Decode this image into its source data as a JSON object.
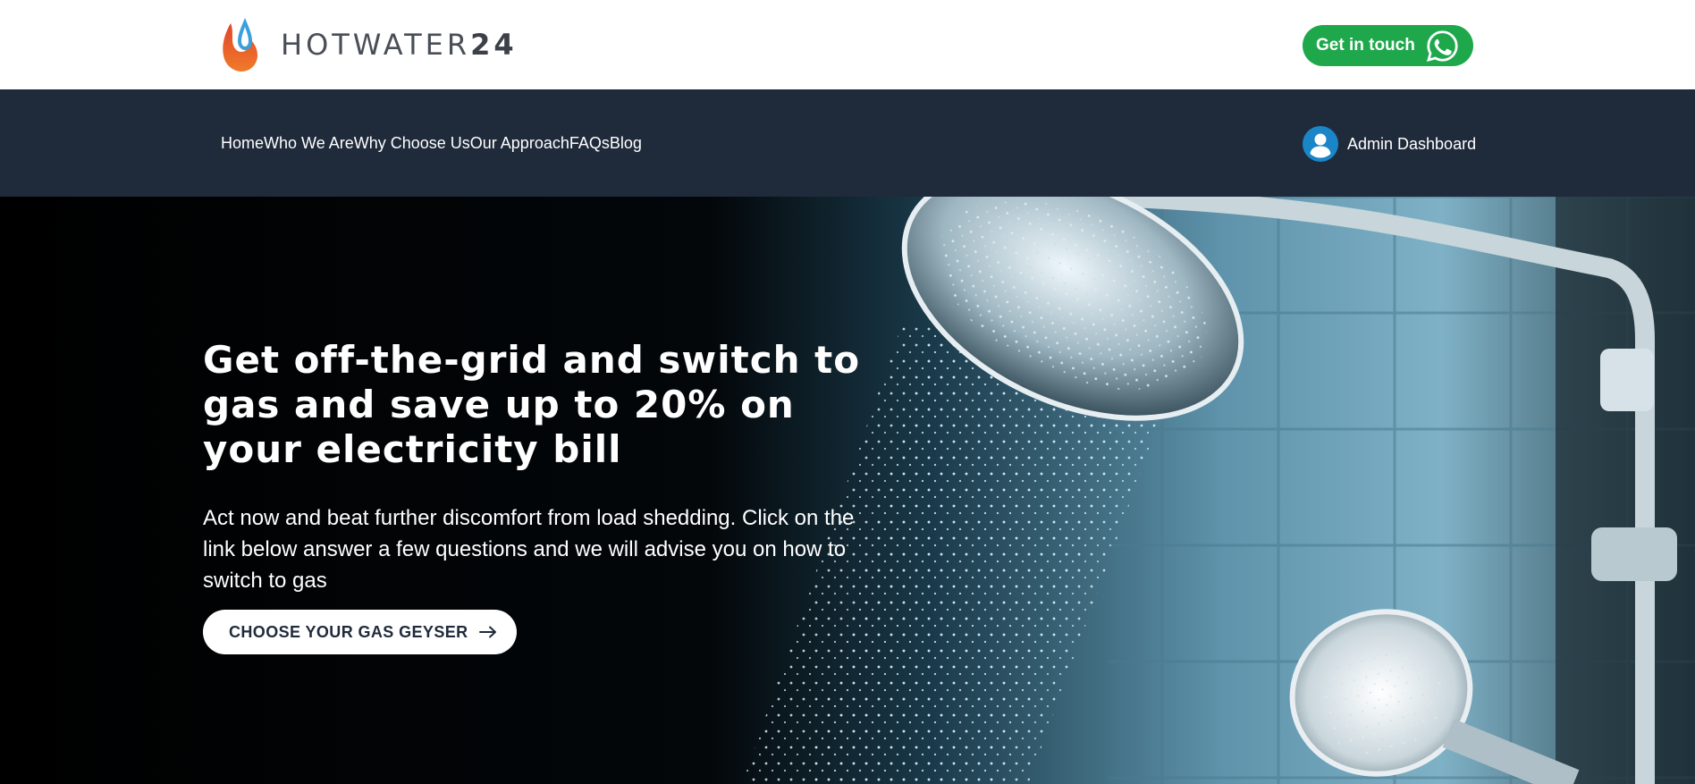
{
  "header": {
    "logo_word": "HOTWATER",
    "logo_number": "24",
    "cta_label": "Get in touch",
    "cta_icon": "whatsapp-icon"
  },
  "nav": {
    "items": [
      {
        "label": "Home"
      },
      {
        "label": "Who We Are"
      },
      {
        "label": "Why Choose Us"
      },
      {
        "label": "Our Approach"
      },
      {
        "label": "FAQs"
      },
      {
        "label": "Blog"
      }
    ],
    "admin_label": "Admin Dashboard",
    "admin_icon": "user-icon"
  },
  "hero": {
    "title": "Get off-the-grid and switch to gas and save up to 20% on your electricity bill",
    "subtitle": "Act now and beat further discomfort from load shedding. Click on the link below answer a few questions and we will advise you on how to switch to gas",
    "button_label": "CHOOSE YOUR GAS GEYSER",
    "button_icon": "arrow-right-icon"
  },
  "colors": {
    "header_bg": "#ffffff",
    "nav_bg": "#1f2a3b",
    "cta_green": "#1ea84b",
    "admin_icon_blue": "#1a86c8",
    "logo_red": "#e0452b",
    "logo_blue": "#3aa0dc",
    "hero_text": "#ffffff"
  }
}
